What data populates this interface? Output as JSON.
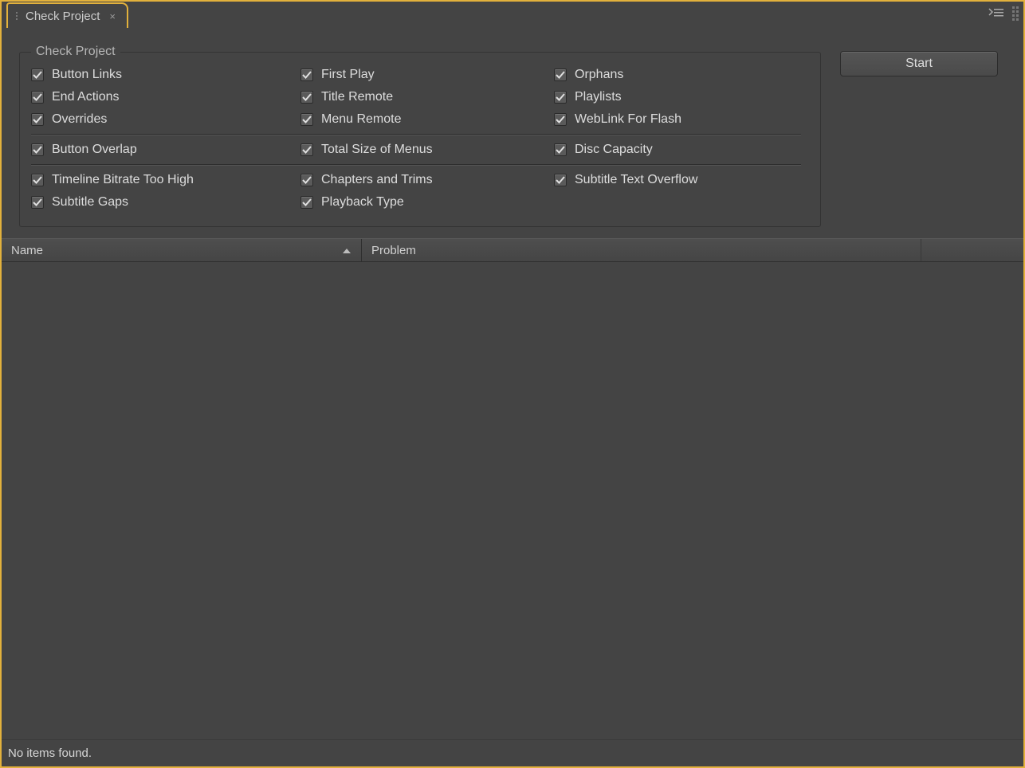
{
  "tab": {
    "title": "Check Project"
  },
  "group": {
    "legend": "Check Project",
    "rows": [
      [
        {
          "label": "Button Links",
          "checked": true
        },
        {
          "label": "First Play",
          "checked": true
        },
        {
          "label": "Orphans",
          "checked": true
        }
      ],
      [
        {
          "label": "End Actions",
          "checked": true
        },
        {
          "label": "Title Remote",
          "checked": true
        },
        {
          "label": "Playlists",
          "checked": true
        }
      ],
      [
        {
          "label": "Overrides",
          "checked": true
        },
        {
          "label": "Menu Remote",
          "checked": true
        },
        {
          "label": "WebLink For Flash",
          "checked": true
        }
      ],
      "divider",
      [
        {
          "label": "Button Overlap",
          "checked": true
        },
        {
          "label": "Total Size of Menus",
          "checked": true
        },
        {
          "label": "Disc Capacity",
          "checked": true
        }
      ],
      "divider",
      [
        {
          "label": "Timeline Bitrate Too High",
          "checked": true
        },
        {
          "label": "Chapters and Trims",
          "checked": true
        },
        {
          "label": "Subtitle Text Overflow",
          "checked": true
        }
      ],
      [
        {
          "label": "Subtitle Gaps",
          "checked": true
        },
        {
          "label": "Playback Type",
          "checked": true
        },
        null
      ]
    ]
  },
  "buttons": {
    "start": "Start"
  },
  "table": {
    "columns": {
      "name": "Name",
      "problem": "Problem"
    }
  },
  "status": "No items found."
}
